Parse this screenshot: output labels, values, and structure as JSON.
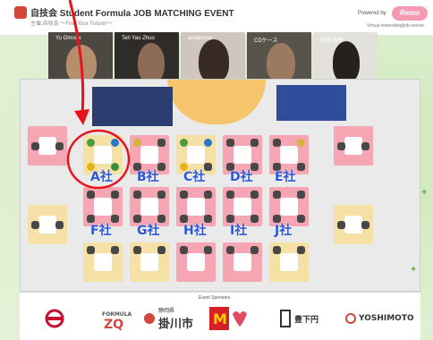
{
  "header": {
    "title": "自技会 Student Formula JOB MATCHING EVENT",
    "subtitle": "主催:自技会 〜Find Your Future!〜",
    "powered_by": "Powered by",
    "brand": "Remo",
    "brand_sub": "Virtual networking/job events"
  },
  "videos": [
    {
      "name": "Yu Omoda"
    },
    {
      "name": "Teh Yao Zhuo"
    },
    {
      "name": "ariyamura"
    },
    {
      "name": "CDケース"
    },
    {
      "name": "鉄田 翔平"
    }
  ],
  "companies": [
    {
      "label": "A社"
    },
    {
      "label": "B社"
    },
    {
      "label": "C社"
    },
    {
      "label": "D社"
    },
    {
      "label": "E社"
    },
    {
      "label": "F社"
    },
    {
      "label": "G社"
    },
    {
      "label": "H社"
    },
    {
      "label": "I社"
    },
    {
      "label": "J社"
    }
  ],
  "sponsors": {
    "heading": "Event Sponsors",
    "kakegawa": "掛川市",
    "shizuoka": "静岡県",
    "toyo": "豊下円",
    "yoshimoto": "YOSHIMOTO"
  },
  "colors": {
    "highlight": "#e8131b",
    "company_label": "#2b57d8",
    "pink_room": "#f6a6b2",
    "yellow_room": "#f5e0a6",
    "background": "#d7ecc4"
  }
}
